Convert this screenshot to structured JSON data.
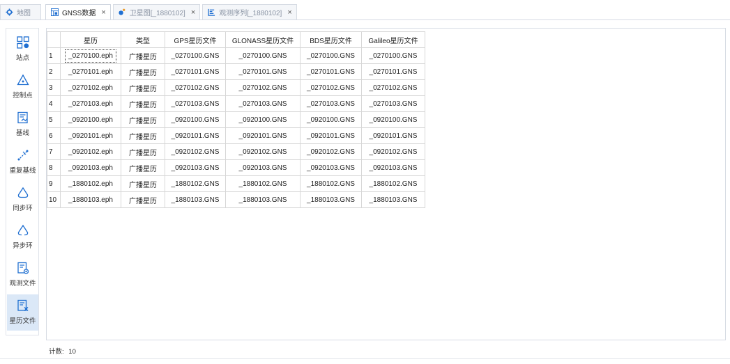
{
  "tabs": [
    {
      "label": "地图",
      "icon": "gear-icon",
      "active": false,
      "closable": false
    },
    {
      "label": "GNSS数据",
      "icon": "table-icon",
      "active": true,
      "closable": true
    },
    {
      "label": "卫星图[_1880102]",
      "icon": "satellite-icon",
      "active": false,
      "closable": true
    },
    {
      "label": "观测序列[_1880102]",
      "icon": "chart-icon",
      "active": false,
      "closable": true
    }
  ],
  "close_glyph": "×",
  "sidebar": {
    "items": [
      {
        "label": "站点",
        "icon": "station-grid-icon"
      },
      {
        "label": "控制点",
        "icon": "control-point-icon"
      },
      {
        "label": "基线",
        "icon": "baseline-icon"
      },
      {
        "label": "重复基线",
        "icon": "repeat-baseline-icon"
      },
      {
        "label": "同步环",
        "icon": "sync-loop-icon"
      },
      {
        "label": "异步环",
        "icon": "async-loop-icon"
      },
      {
        "label": "观测文件",
        "icon": "observation-file-icon"
      },
      {
        "label": "星历文件",
        "icon": "ephemeris-file-icon",
        "active": true
      }
    ]
  },
  "table": {
    "columns": [
      "",
      "星历",
      "类型",
      "GPS星历文件",
      "GLONASS星历文件",
      "BDS星历文件",
      "Galileo星历文件"
    ],
    "rows": [
      [
        "1",
        "_0270100.eph",
        "广播星历",
        "_0270100.GNS",
        "_0270100.GNS",
        "_0270100.GNS",
        "_0270100.GNS"
      ],
      [
        "2",
        "_0270101.eph",
        "广播星历",
        "_0270101.GNS",
        "_0270101.GNS",
        "_0270101.GNS",
        "_0270101.GNS"
      ],
      [
        "3",
        "_0270102.eph",
        "广播星历",
        "_0270102.GNS",
        "_0270102.GNS",
        "_0270102.GNS",
        "_0270102.GNS"
      ],
      [
        "4",
        "_0270103.eph",
        "广播星历",
        "_0270103.GNS",
        "_0270103.GNS",
        "_0270103.GNS",
        "_0270103.GNS"
      ],
      [
        "5",
        "_0920100.eph",
        "广播星历",
        "_0920100.GNS",
        "_0920100.GNS",
        "_0920100.GNS",
        "_0920100.GNS"
      ],
      [
        "6",
        "_0920101.eph",
        "广播星历",
        "_0920101.GNS",
        "_0920101.GNS",
        "_0920101.GNS",
        "_0920101.GNS"
      ],
      [
        "7",
        "_0920102.eph",
        "广播星历",
        "_0920102.GNS",
        "_0920102.GNS",
        "_0920102.GNS",
        "_0920102.GNS"
      ],
      [
        "8",
        "_0920103.eph",
        "广播星历",
        "_0920103.GNS",
        "_0920103.GNS",
        "_0920103.GNS",
        "_0920103.GNS"
      ],
      [
        "9",
        "_1880102.eph",
        "广播星历",
        "_1880102.GNS",
        "_1880102.GNS",
        "_1880102.GNS",
        "_1880102.GNS"
      ],
      [
        "10",
        "_1880103.eph",
        "广播星历",
        "_1880103.GNS",
        "_1880103.GNS",
        "_1880103.GNS",
        "_1880103.GNS"
      ]
    ]
  },
  "status": {
    "count_label": "计数:",
    "count_value": "10"
  },
  "colors": {
    "accent": "#1f6fd1",
    "active_nav_bg": "#dbe8f7",
    "grid_border": "#d7d7d7"
  }
}
